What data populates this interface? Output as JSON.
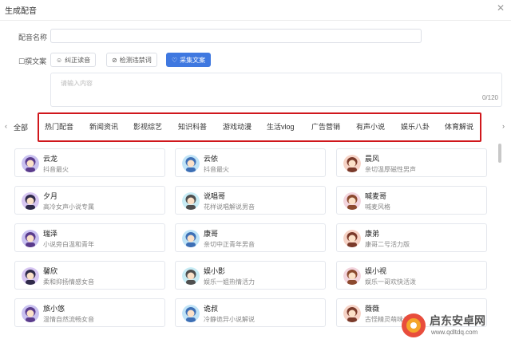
{
  "dialog": {
    "title": "生成配音"
  },
  "form": {
    "name_label": "配音名称",
    "name_value": "",
    "text_label": "☐撰文案",
    "buttons": [
      {
        "label": "纠正读音",
        "icon": "smile-circle-icon"
      },
      {
        "label": "检测违禁词",
        "icon": "ban-icon"
      },
      {
        "label": "采集文案",
        "icon": "heart-icon"
      }
    ],
    "textarea_placeholder": "请输入内容",
    "counter": "0/120"
  },
  "tabs": {
    "all_label": "全部",
    "items": [
      "热门配音",
      "新闻资讯",
      "影视综艺",
      "知识科普",
      "游戏动漫",
      "生活vlog",
      "广告营销",
      "有声小说",
      "娱乐八卦",
      "体育解说"
    ]
  },
  "voices": [
    {
      "name": "云龙",
      "desc": "抖音最火"
    },
    {
      "name": "云依",
      "desc": "抖音最火"
    },
    {
      "name": "晨风",
      "desc": "亲切温厚磁性男声"
    },
    {
      "name": "夕月",
      "desc": "高冷女声小说专属"
    },
    {
      "name": "说唱哥",
      "desc": "花样说唱解说男音"
    },
    {
      "name": "喊麦哥",
      "desc": "喊麦风格"
    },
    {
      "name": "瑞泽",
      "desc": "小说旁白温和青年"
    },
    {
      "name": "康哥",
      "desc": "亲切中正青年男音"
    },
    {
      "name": "康弟",
      "desc": "康哥二号活力版"
    },
    {
      "name": "馨欣",
      "desc": "柔和抑扬情感女音"
    },
    {
      "name": "娱小影",
      "desc": "娱乐一姐热情活力"
    },
    {
      "name": "娱小视",
      "desc": "娱乐一哥欢快活泼"
    },
    {
      "name": "旅小悠",
      "desc": "温情自然流畅女音"
    },
    {
      "name": "诡叔",
      "desc": "冷静诡异小说解说"
    },
    {
      "name": "薇薇",
      "desc": "古怪精灵萌味音"
    }
  ],
  "watermark": {
    "text": "启东安卓网",
    "url": "www.qdltdq.com"
  }
}
